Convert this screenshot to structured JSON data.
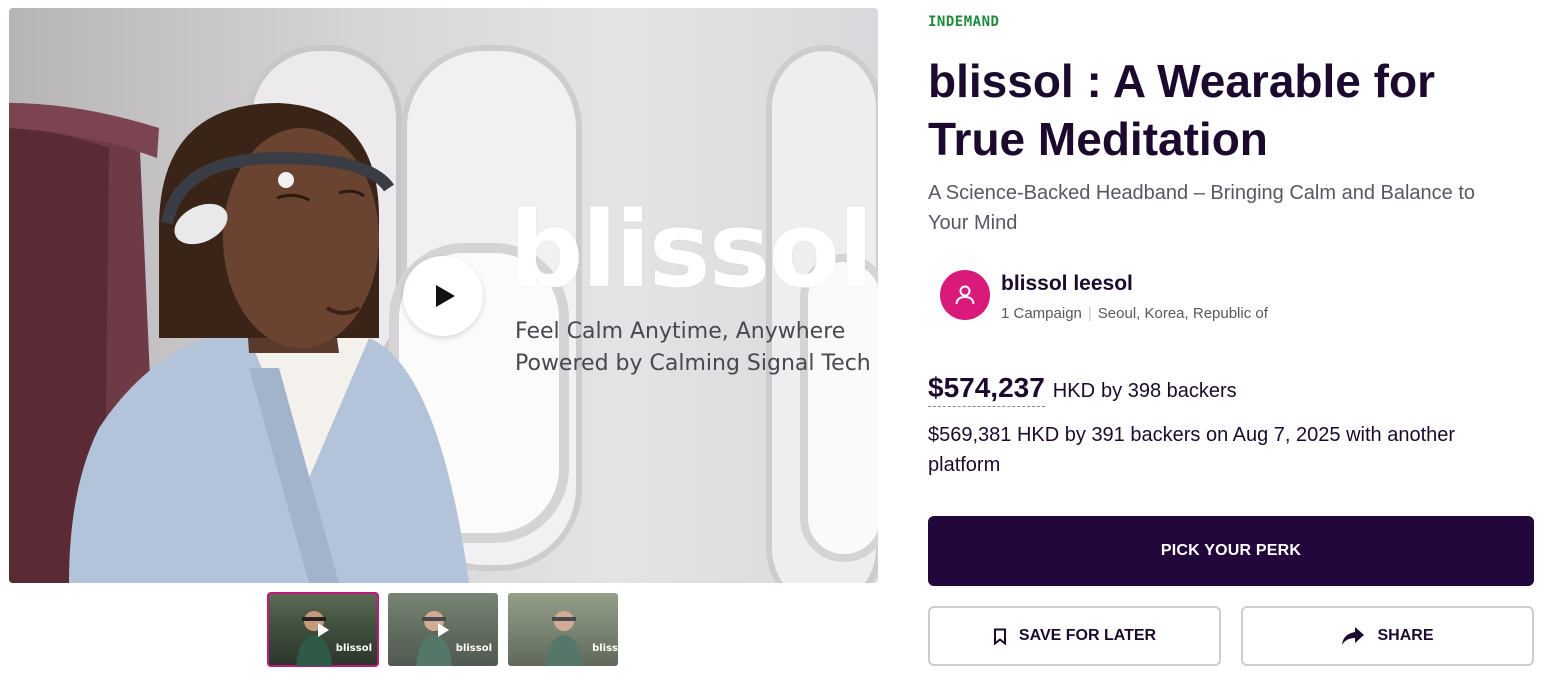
{
  "media": {
    "overlay_brand": "blissol",
    "overlay_tagline_1": "Feel Calm Anytime, Anywhere",
    "overlay_tagline_2": "Powered by Calming Signal Tech",
    "thumbnails": [
      {
        "brand": "blissol",
        "has_play": true,
        "active": true
      },
      {
        "brand": "blissol",
        "has_play": true,
        "active": false
      },
      {
        "brand": "bliss",
        "has_play": false,
        "active": false
      }
    ]
  },
  "campaign": {
    "platform_label": "INDEMAND",
    "title": "blissol : A Wearable for True Meditation",
    "subtitle": "A Science-Backed Headband – Bringing Calm and Balance to Your Mind"
  },
  "owner": {
    "name": "blissol leesol",
    "campaigns": "1 Campaign",
    "location": "Seoul, Korea, Republic of",
    "avatar_icon": "user-icon"
  },
  "funding": {
    "amount": "$574,237",
    "currency": "HKD",
    "backers_text": "by 398 backers",
    "prior_text": "$569,381 HKD by 391 backers on Aug 7, 2025 with another platform"
  },
  "actions": {
    "primary_label": "PICK YOUR PERK",
    "save_label": "SAVE FOR LATER",
    "share_label": "SHARE"
  },
  "colors": {
    "primary_button": "#22073d",
    "platform_green": "#1e8a3b",
    "avatar_pink": "#d91a7a",
    "active_thumb_outline": "#c1197a"
  }
}
